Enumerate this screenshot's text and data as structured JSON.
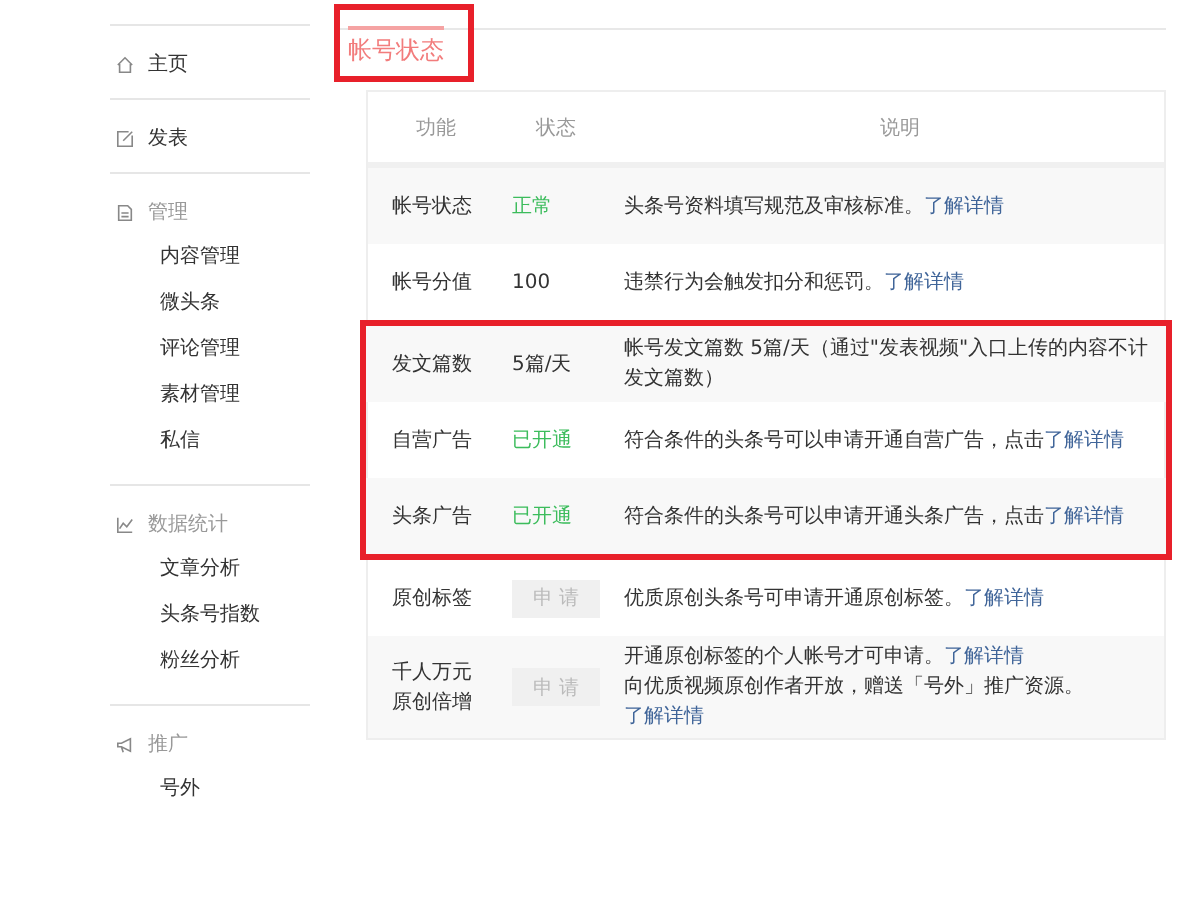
{
  "sidebar": {
    "sections": [
      {
        "label": "主页",
        "kind": "link"
      },
      {
        "label": "发表",
        "kind": "link"
      },
      {
        "label": "管理",
        "kind": "group",
        "items": [
          "内容管理",
          "微头条",
          "评论管理",
          "素材管理",
          "私信"
        ]
      },
      {
        "label": "数据统计",
        "kind": "group",
        "items": [
          "文章分析",
          "头条号指数",
          "粉丝分析"
        ]
      },
      {
        "label": "推广",
        "kind": "group",
        "items": [
          "号外"
        ]
      }
    ]
  },
  "tabs": [
    {
      "label": "帐号状态",
      "selected": true,
      "highlighted": true
    }
  ],
  "table": {
    "columns": [
      "功能",
      "状态",
      "说明"
    ],
    "rows": [
      {
        "feature": [
          "帐号状态"
        ],
        "status": {
          "kind": "ok",
          "text": "正常"
        },
        "desc": [
          {
            "text": "头条号资料填写规范及审核标准。",
            "link": "了解详情"
          }
        ],
        "highlighted": false
      },
      {
        "feature": [
          "帐号分值"
        ],
        "status": {
          "kind": "text",
          "text": "100"
        },
        "desc": [
          {
            "text": "违禁行为会触发扣分和惩罚。",
            "link": "了解详情"
          }
        ],
        "highlighted": false
      },
      {
        "feature": [
          "发文篇数"
        ],
        "status": {
          "kind": "text",
          "text": "5篇/天"
        },
        "desc": [
          {
            "text": "帐号发文篇数 5篇/天（通过\"发表视频\"入口上传的内容不计发文篇数）"
          }
        ],
        "highlighted": true
      },
      {
        "feature": [
          "自营广告"
        ],
        "status": {
          "kind": "ok",
          "text": "已开通"
        },
        "desc": [
          {
            "text": "符合条件的头条号可以申请开通自营广告，点击",
            "link": "了解详情"
          }
        ],
        "highlighted": true
      },
      {
        "feature": [
          "头条广告"
        ],
        "status": {
          "kind": "ok",
          "text": "已开通"
        },
        "desc": [
          {
            "text": "符合条件的头条号可以申请开通头条广告，点击",
            "link": "了解详情"
          }
        ],
        "highlighted": true
      },
      {
        "feature": [
          "原创标签"
        ],
        "status": {
          "kind": "button",
          "text": "申 请"
        },
        "desc": [
          {
            "text": "优质原创头条号可申请开通原创标签。",
            "link": "了解详情"
          }
        ],
        "highlighted": false
      },
      {
        "feature": [
          "千人万元",
          "原创倍增"
        ],
        "status": {
          "kind": "button",
          "text": "申 请"
        },
        "desc": [
          {
            "text": "开通原创标签的个人帐号才可申请。",
            "link": "了解详情"
          },
          {
            "text": "向优质视频原创作者开放，赠送「号外」推广资源。",
            "link": "了解详情"
          }
        ],
        "highlighted": false
      }
    ]
  }
}
